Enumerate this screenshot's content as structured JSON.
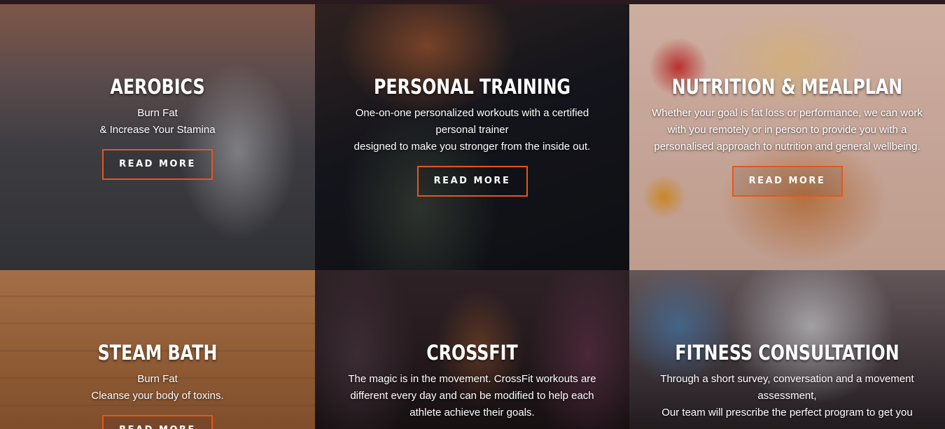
{
  "read_more_label": "READ MORE",
  "accent_color": "#e8551e",
  "services": [
    {
      "title": "AEROBICS",
      "lines": [
        "Burn Fat",
        "& Increase Your Stamina"
      ]
    },
    {
      "title": "PERSONAL TRAINING",
      "lines": [
        "One-on-one personalized workouts with a certified",
        "personal trainer",
        "designed to make you stronger from the inside out."
      ]
    },
    {
      "title": "NUTRITION & MEALPLAN",
      "lines": [
        "Whether your goal is fat loss or performance, we can work",
        "with you remotely or in person to provide you with a",
        "personalised approach to nutrition and general wellbeing."
      ]
    },
    {
      "title": "STEAM BATH",
      "lines": [
        "Burn Fat",
        "Cleanse your body of toxins."
      ]
    },
    {
      "title": "CROSSFIT",
      "lines": [
        "The magic is in the movement. CrossFit workouts are",
        "different every day and can be modified to help each",
        "athlete achieve their goals."
      ]
    },
    {
      "title": "FITNESS CONSULTATION",
      "lines": [
        "Through a short survey, conversation and a movement",
        "assessment,",
        "Our team will prescribe the perfect program to get you"
      ]
    }
  ]
}
